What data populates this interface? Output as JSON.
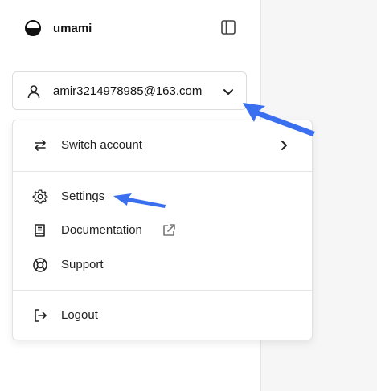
{
  "brand": {
    "name": "umami"
  },
  "account": {
    "email": "amir3214978985@163.com"
  },
  "menu": {
    "switch_account": "Switch account",
    "settings": "Settings",
    "documentation": "Documentation",
    "support": "Support",
    "logout": "Logout"
  },
  "colors": {
    "annotation_arrow": "#3a6ff0",
    "border": "#e2e2e2"
  }
}
